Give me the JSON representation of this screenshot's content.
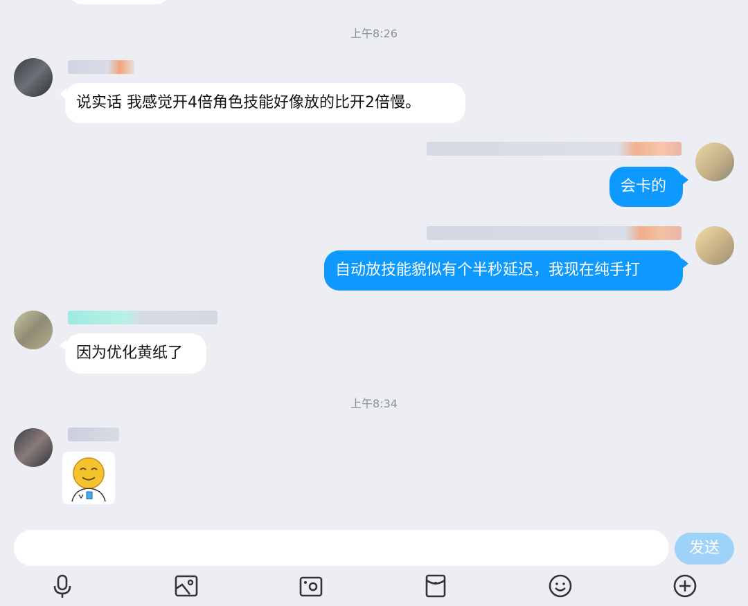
{
  "times": [
    "上午8:26",
    "上午8:34"
  ],
  "messages": [
    {
      "side": "left",
      "text": "说实话 我感觉开4倍角色技能好像放的比开2倍慢。"
    },
    {
      "side": "right",
      "text": "会卡的"
    },
    {
      "side": "right",
      "text": "自动放技能貌似有个半秒延迟，我现在纯手打"
    },
    {
      "side": "left",
      "text": "因为优化黄纸了"
    },
    {
      "side": "left",
      "type": "sticker",
      "sticker": "yellow-face-sticker"
    }
  ],
  "input": {
    "placeholder": "",
    "send_label": "发送"
  },
  "toolbar": [
    {
      "name": "microphone-icon"
    },
    {
      "name": "image-icon"
    },
    {
      "name": "camera-icon"
    },
    {
      "name": "red-packet-icon"
    },
    {
      "name": "emoji-icon"
    },
    {
      "name": "plus-icon"
    }
  ],
  "colors": {
    "background": "#eceef4",
    "self_bubble": "#0e99ff",
    "other_bubble": "#ffffff",
    "send_button": "#9fd2f8"
  }
}
